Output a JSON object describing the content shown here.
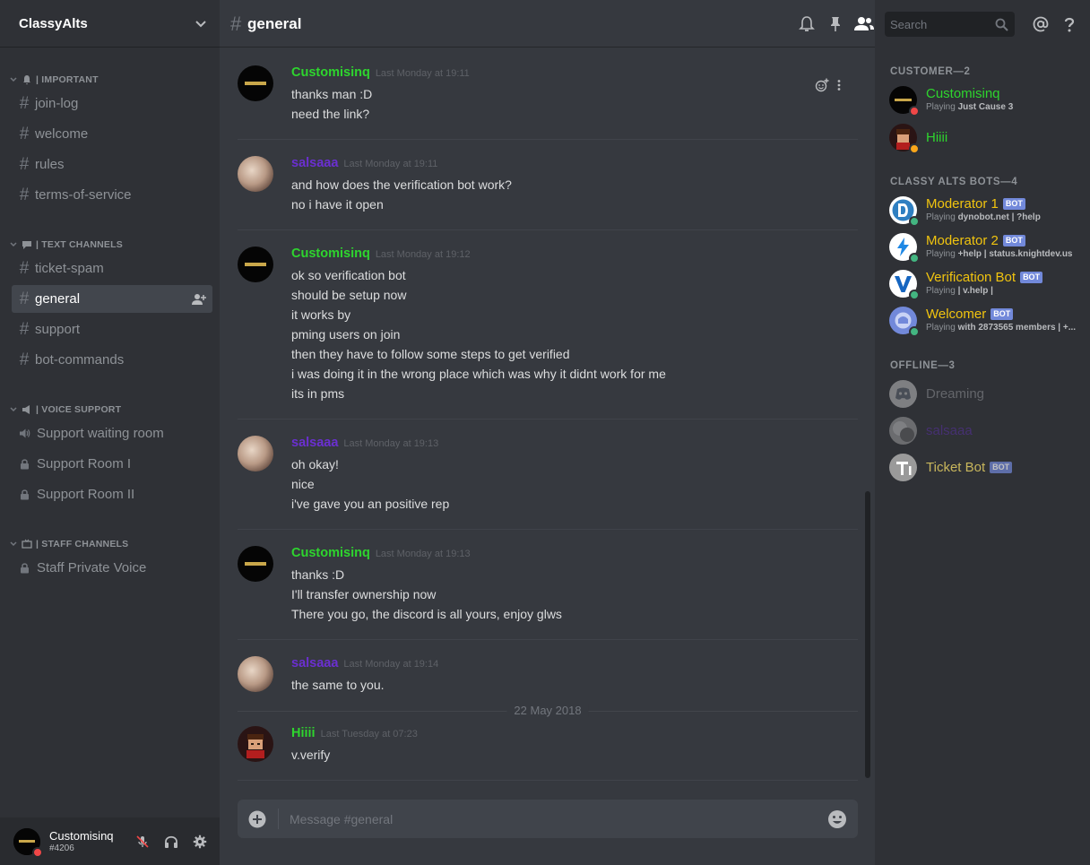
{
  "server": {
    "name": "ClassyAlts"
  },
  "sidebar": {
    "categories": [
      {
        "label": "| IMPORTANT"
      },
      {
        "label": "| TEXT CHANNELS"
      },
      {
        "label": "| VOICE SUPPORT"
      },
      {
        "label": "| STAFF CHANNELS"
      }
    ],
    "channels": [
      {
        "label": "join-log"
      },
      {
        "label": "welcome"
      },
      {
        "label": "rules"
      },
      {
        "label": "terms-of-service"
      },
      {
        "label": "ticket-spam"
      },
      {
        "label": "general"
      },
      {
        "label": "support"
      },
      {
        "label": "bot-commands"
      },
      {
        "label": "Support waiting room"
      },
      {
        "label": "Support Room I"
      },
      {
        "label": "Support Room II"
      },
      {
        "label": "Staff Private Voice"
      }
    ]
  },
  "user": {
    "name": "Customisinq",
    "tag": "#4206"
  },
  "chat": {
    "hash": "#",
    "channel": "general",
    "search_placeholder": "Search",
    "composer_placeholder": "Message #general",
    "date_divider": "22 May 2018",
    "messages": [
      {
        "author": "Customisinq",
        "time": "Last Monday at 19:11",
        "color": "#43b581",
        "lines": [
          "thanks man :D",
          "need the link?"
        ]
      },
      {
        "author": "salsaaa",
        "time": "Last Monday at 19:11",
        "color": "#6b2fd1",
        "lines": [
          "and how does the verification bot work?",
          "no i have it open"
        ]
      },
      {
        "author": "Customisinq",
        "time": "Last Monday at 19:12",
        "color": "#43b581",
        "lines": [
          "ok so verification bot",
          "should be setup now",
          "it works by",
          "pming users on join",
          "then they have to follow some steps to get verified",
          "i was doing it in the wrong place which was why it didnt work for me",
          "its in pms"
        ]
      },
      {
        "author": "salsaaa",
        "time": "Last Monday at 19:13",
        "color": "#6b2fd1",
        "lines": [
          "oh okay!",
          "nice",
          "i've gave you an positive rep"
        ]
      },
      {
        "author": "Customisinq",
        "time": "Last Monday at 19:13",
        "color": "#43b581",
        "lines": [
          "thanks :D",
          "I'll transfer ownership now",
          "There you go, the discord is all yours, enjoy glws"
        ]
      },
      {
        "author": "salsaaa",
        "time": "Last Monday at 19:14",
        "color": "#6b2fd1",
        "lines": [
          "the same to you."
        ]
      },
      {
        "author": "Hiiii",
        "time": "Last Tuesday at 07:23",
        "color": "#43b581",
        "lines": [
          "v.verify"
        ]
      }
    ]
  },
  "members": {
    "sections": [
      {
        "label": "CUSTOMER—2"
      },
      {
        "label": "CLASSY ALTS BOTS—4"
      },
      {
        "label": "OFFLINE—3"
      }
    ],
    "list": [
      {
        "name": "Customisinq",
        "color": "#2ed52e",
        "activity_prefix": "Playing ",
        "activity": "Just Cause 3",
        "status": "dnd"
      },
      {
        "name": "Hiiii",
        "color": "#2ed52e",
        "activity_prefix": "",
        "activity": "",
        "status": "idle"
      },
      {
        "name": "Moderator 1",
        "color": "#f1c40f",
        "bot": "BOT",
        "activity_prefix": "Playing ",
        "activity": "dynobot.net | ?help",
        "status": "online"
      },
      {
        "name": "Moderator 2",
        "color": "#f1c40f",
        "bot": "BOT",
        "activity_prefix": "Playing ",
        "activity": "+help | status.knightdev.us",
        "status": "online"
      },
      {
        "name": "Verification Bot",
        "color": "#f1c40f",
        "bot": "BOT",
        "activity_prefix": "Playing ",
        "activity": "| v.help |",
        "status": "online"
      },
      {
        "name": "Welcomer",
        "color": "#f1c40f",
        "bot": "BOT",
        "activity_prefix": "Playing ",
        "activity": "with 2873565 members | +...",
        "status": "online"
      },
      {
        "name": "Dreaming",
        "color": "#8e9297",
        "activity_prefix": "",
        "activity": "",
        "status": "offline"
      },
      {
        "name": "salsaaa",
        "color": "#6b2fd1",
        "activity_prefix": "",
        "activity": "",
        "status": "offline"
      },
      {
        "name": "Ticket Bot",
        "color": "#f1c40f",
        "bot": "BOT",
        "activity_prefix": "",
        "activity": "",
        "status": "offline"
      }
    ]
  },
  "colors": {
    "online": "#43b581",
    "idle": "#faa61a",
    "dnd": "#f04747",
    "bot_tag": "#7289da"
  },
  "icons": [
    "chevron-down-icon",
    "bell-icon",
    "pin-icon",
    "members-icon",
    "search-icon",
    "mention-icon",
    "help-icon",
    "mute-icon",
    "headphones-icon",
    "gear-icon",
    "emoji-icon",
    "plus-icon",
    "more-icon",
    "speaker-icon",
    "lock-icon",
    "invite-icon"
  ]
}
